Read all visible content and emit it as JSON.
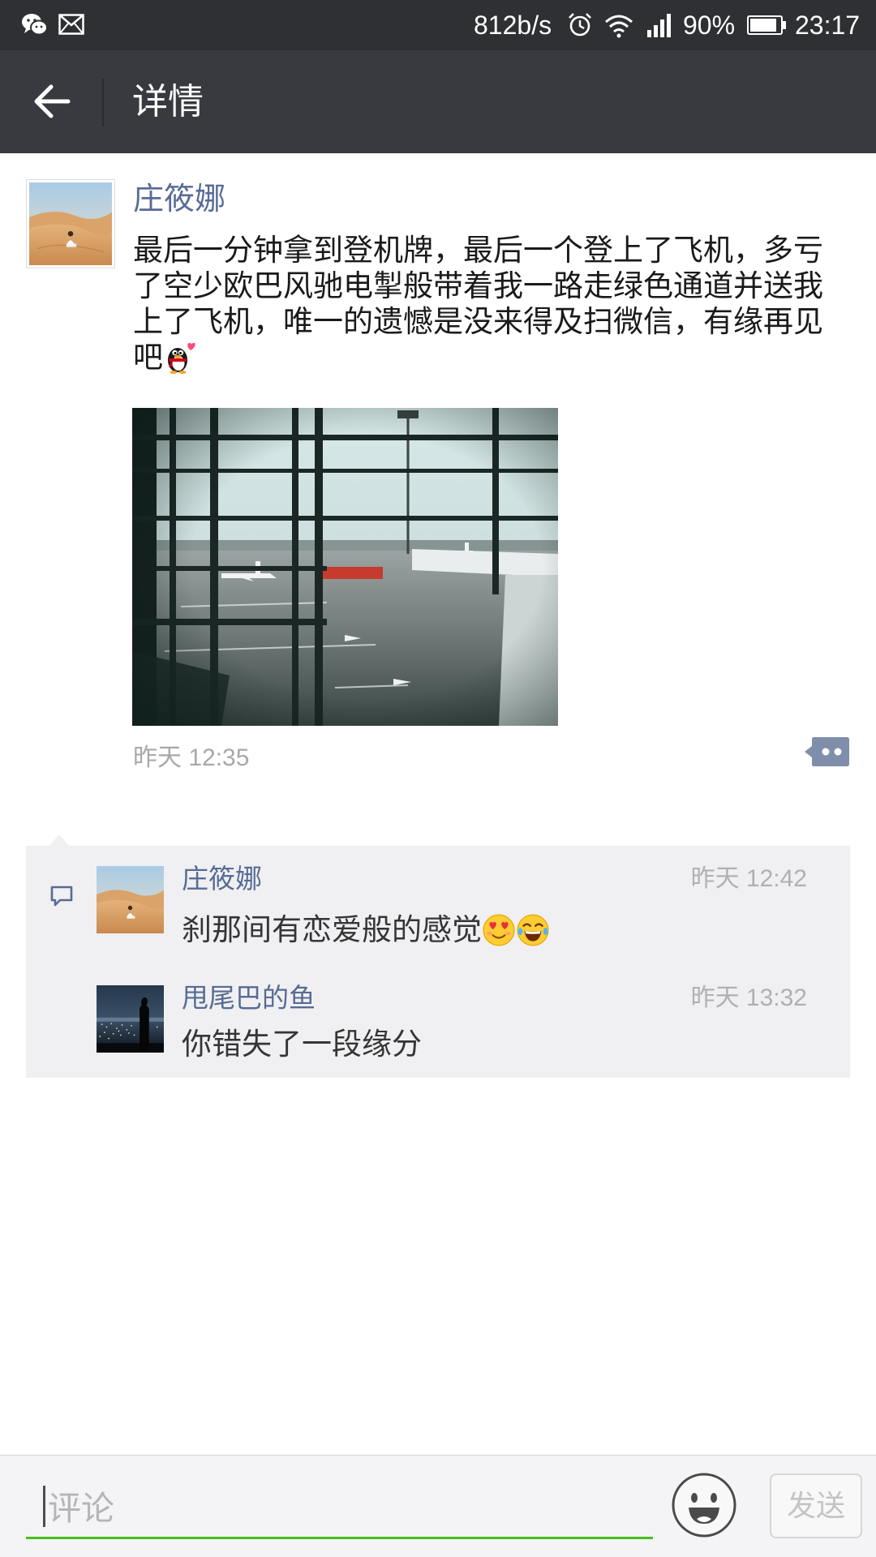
{
  "status_bar": {
    "left_icons": [
      "wechat-icon",
      "mail-icon"
    ],
    "network_speed": "812b/s",
    "right_icons": [
      "alarm-icon",
      "wifi-icon",
      "signal-icon",
      "battery-icon"
    ],
    "battery_percent": "90%",
    "battery_level": 0.9,
    "time": "23:17"
  },
  "header": {
    "back_icon": "arrow-left-icon",
    "title": "详情"
  },
  "post": {
    "author": "庄筱娜",
    "avatar": "desert-photo-avatar",
    "text": "最后一分钟拿到登机牌，最后一个登上了飞机，多亏了空少欧巴风驰电掣般带着我一路走绿色通道并送我上了飞机，唯一的遗憾是没来得及扫微信，有缘再见吧",
    "text_emoji": "penguin-heart-emoji",
    "photo": "airport-window-photo",
    "timestamp": "昨天 12:35",
    "options_icon": "comment-options-icon"
  },
  "comments": {
    "icon": "comment-bubble-icon",
    "items": [
      {
        "author": "庄筱娜",
        "avatar": "desert-photo-avatar",
        "time": "昨天 12:42",
        "text": "刹那间有恋爱般的感觉",
        "emojis": [
          "heart-eyes-emoji",
          "tears-of-joy-emoji"
        ]
      },
      {
        "author": "甩尾巴的鱼",
        "avatar": "city-night-avatar",
        "time": "昨天 13:32",
        "text": "你错失了一段缘分"
      }
    ]
  },
  "input_bar": {
    "placeholder": "评论",
    "emoji_icon": "smiley-face-icon",
    "send_label": "发送"
  },
  "colors": {
    "status_bar": "#2e3033",
    "header": "#393a3f",
    "name": "#576b95",
    "comment_bg": "#f0f0f2",
    "input_underline": "#45c01a"
  }
}
